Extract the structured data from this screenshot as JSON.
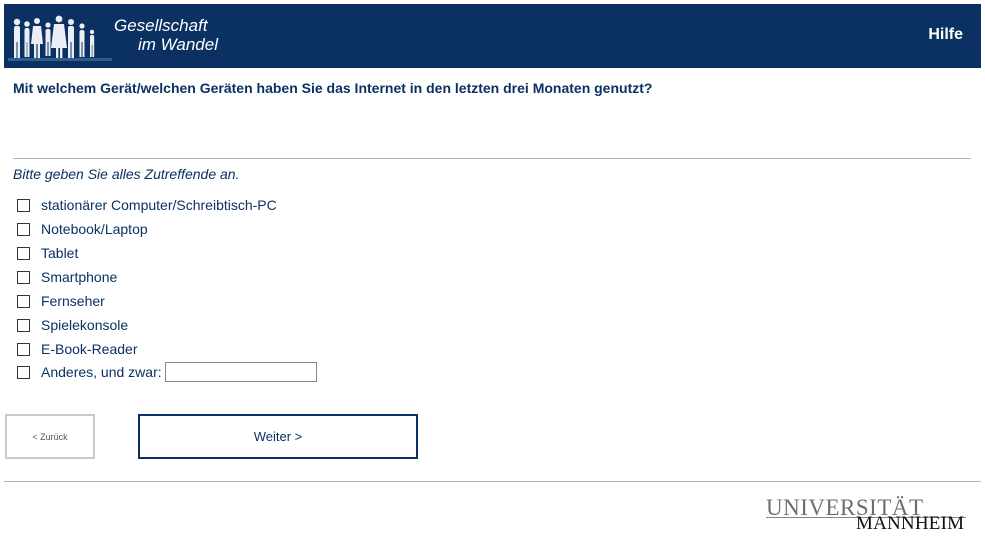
{
  "header": {
    "brand_line1": "Gesellschaft",
    "brand_line2": "im Wandel",
    "help_label": "Hilfe"
  },
  "question": {
    "text": "Mit welchem Gerät/welchen Geräten haben Sie das Internet in den letzten drei Monaten genutzt?",
    "hint": "Bitte geben Sie alles Zutreffende an."
  },
  "options": [
    {
      "label": "stationärer Computer/Schreibtisch-PC",
      "checked": false
    },
    {
      "label": "Notebook/Laptop",
      "checked": false
    },
    {
      "label": "Tablet",
      "checked": false
    },
    {
      "label": "Smartphone",
      "checked": false
    },
    {
      "label": "Fernseher",
      "checked": false
    },
    {
      "label": "Spielekonsole",
      "checked": false
    },
    {
      "label": "E-Book-Reader",
      "checked": false
    },
    {
      "label": "Anderes, und zwar:",
      "checked": false,
      "text_value": ""
    }
  ],
  "nav": {
    "back_label": "< Zurück",
    "next_label": "Weiter >"
  },
  "footer": {
    "logo_line1": "UNIVERSITÄT",
    "logo_line2": "MANNHEIM"
  },
  "colors": {
    "brand_navy": "#0b3163",
    "divider_gray": "#b5b5b5"
  }
}
